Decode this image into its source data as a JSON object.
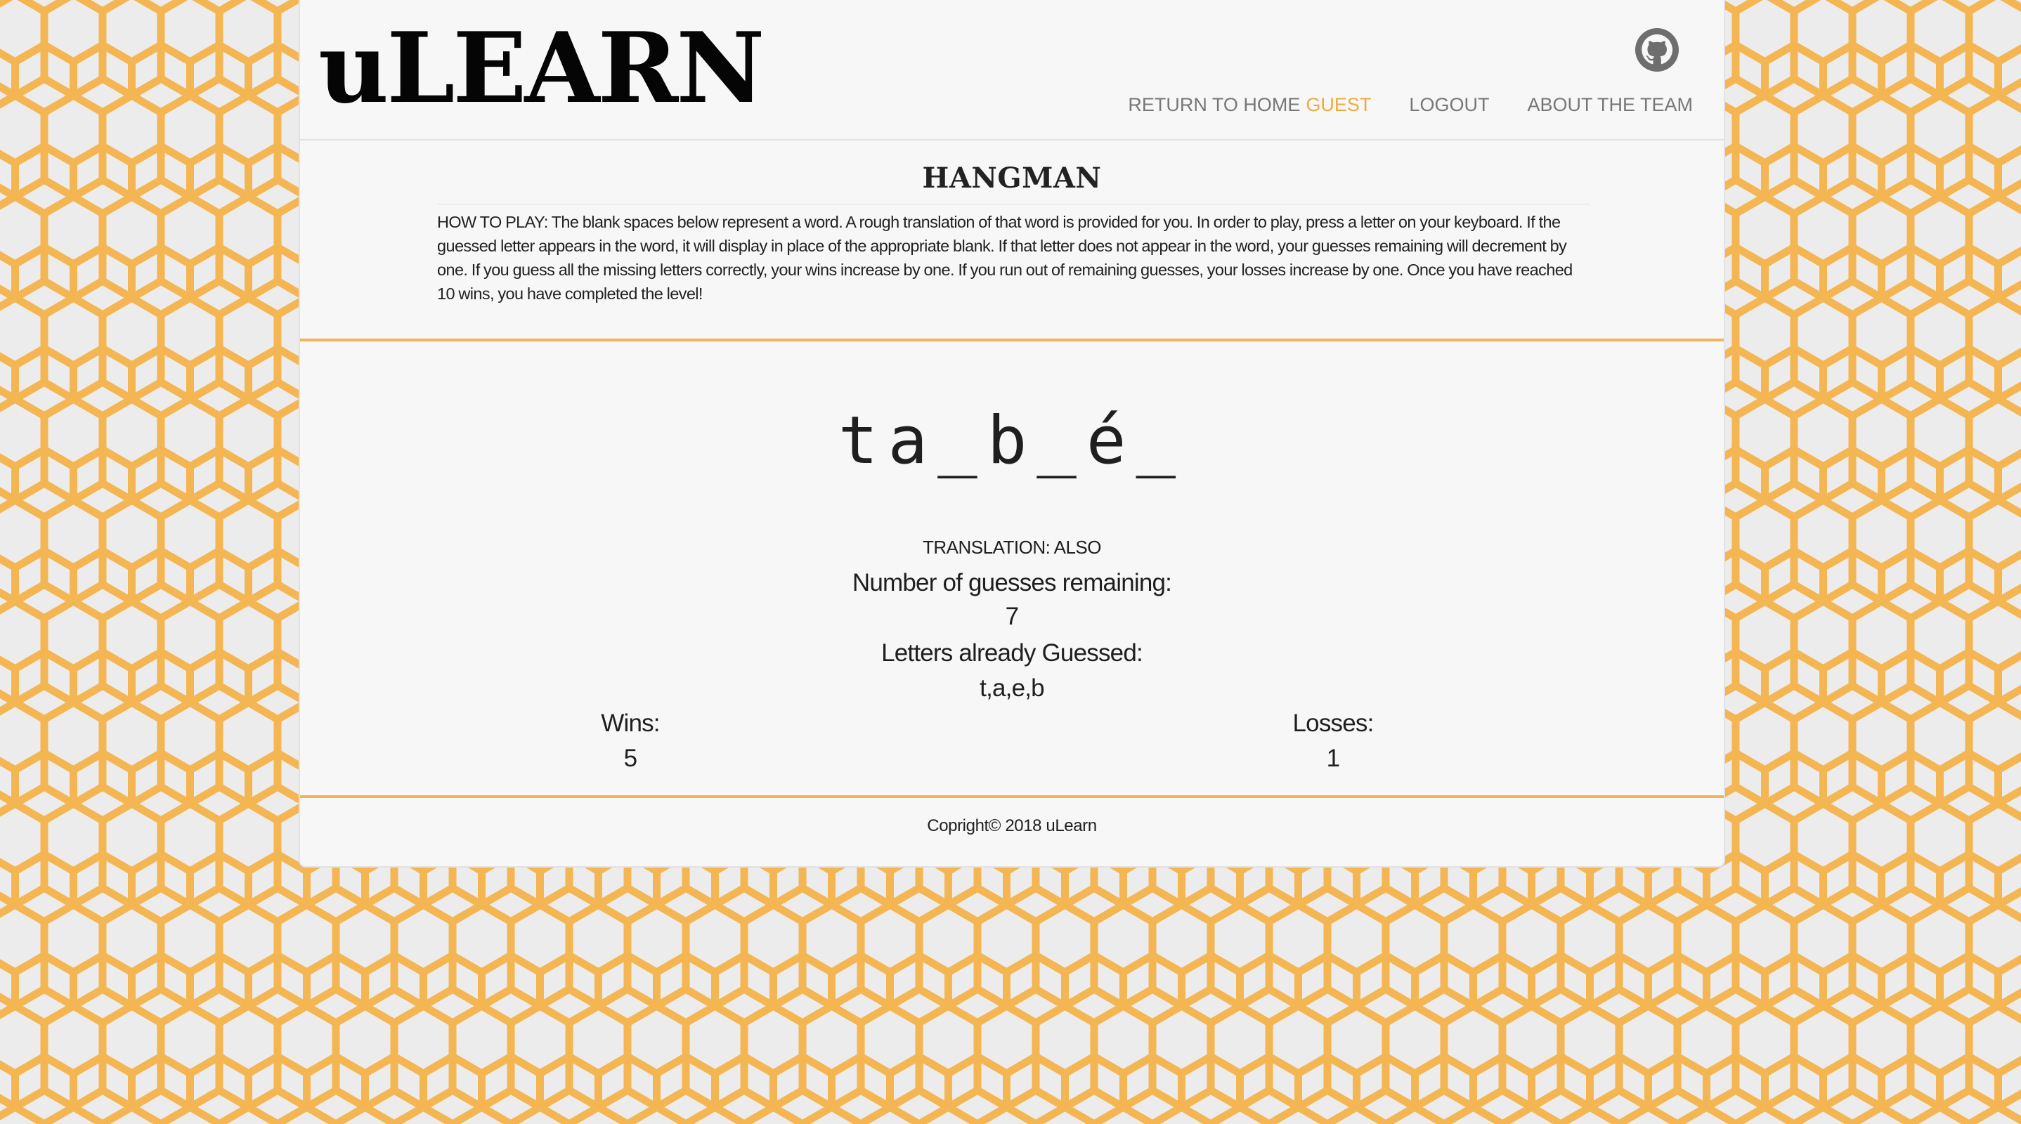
{
  "colors": {
    "accent": "#f2a93b",
    "honeycomb_stroke": "#f4b553",
    "background": "#ececec",
    "card": "#f7f7f7"
  },
  "header": {
    "brand": "uLEARN",
    "github_icon": "github-icon",
    "nav": {
      "home_label": "RETURN TO HOME",
      "user_label": "GUEST",
      "logout_label": "LOGOUT",
      "about_label": "ABOUT THE TEAM"
    }
  },
  "intro": {
    "title": "HANGMAN",
    "instructions": "HOW TO PLAY: The blank spaces below represent a word. A rough translation of that word is provided for you. In order to play, press a letter on your keyboard. If the guessed letter appears in the word, it will display in place of the appropriate blank. If that letter does not appear in the word, your guesses remaining will decrement by one. If you guess all the missing letters correctly, your wins increase by one. If you run out of remaining guesses, your losses increase by one. Once you have reached 10 wins, you have completed the level!"
  },
  "game": {
    "word_display": "ta_b_é_",
    "translation": "TRANSLATION: ALSO",
    "guesses_label": "Number of guesses remaining:",
    "guesses_value": "7",
    "letters_label": "Letters already Guessed:",
    "letters_value": "t,a,e,b",
    "wins_label": "Wins:",
    "wins_value": "5",
    "losses_label": "Losses:",
    "losses_value": "1"
  },
  "footer": {
    "copyright": "Copright© 2018 uLearn"
  }
}
